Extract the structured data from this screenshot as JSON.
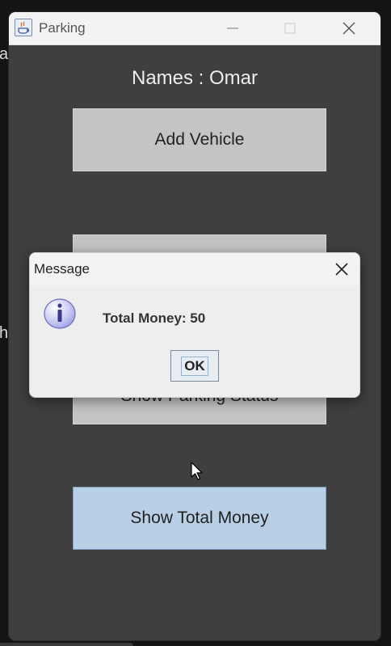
{
  "background": {
    "text_a": "a",
    "text_h": "h"
  },
  "window": {
    "title": "Parking",
    "icon": "java-app-icon",
    "controls": [
      "minimize-icon",
      "maximize-icon",
      "close-icon"
    ]
  },
  "main": {
    "names_label": "Names : Omar",
    "add_vehicle": "Add Vehicle",
    "status_button": "Show Parking Status",
    "show_total_money": "Show Total Money"
  },
  "dialog": {
    "title": "Message",
    "message": "Total Money: 50",
    "ok": "OK",
    "icon": "info-icon"
  },
  "colors": {
    "window_bg": "#3f3f3f",
    "button_bg": "#c4c4c4",
    "focused_button_bg": "#b8cfe5",
    "dialog_bg": "#eeeeee"
  }
}
